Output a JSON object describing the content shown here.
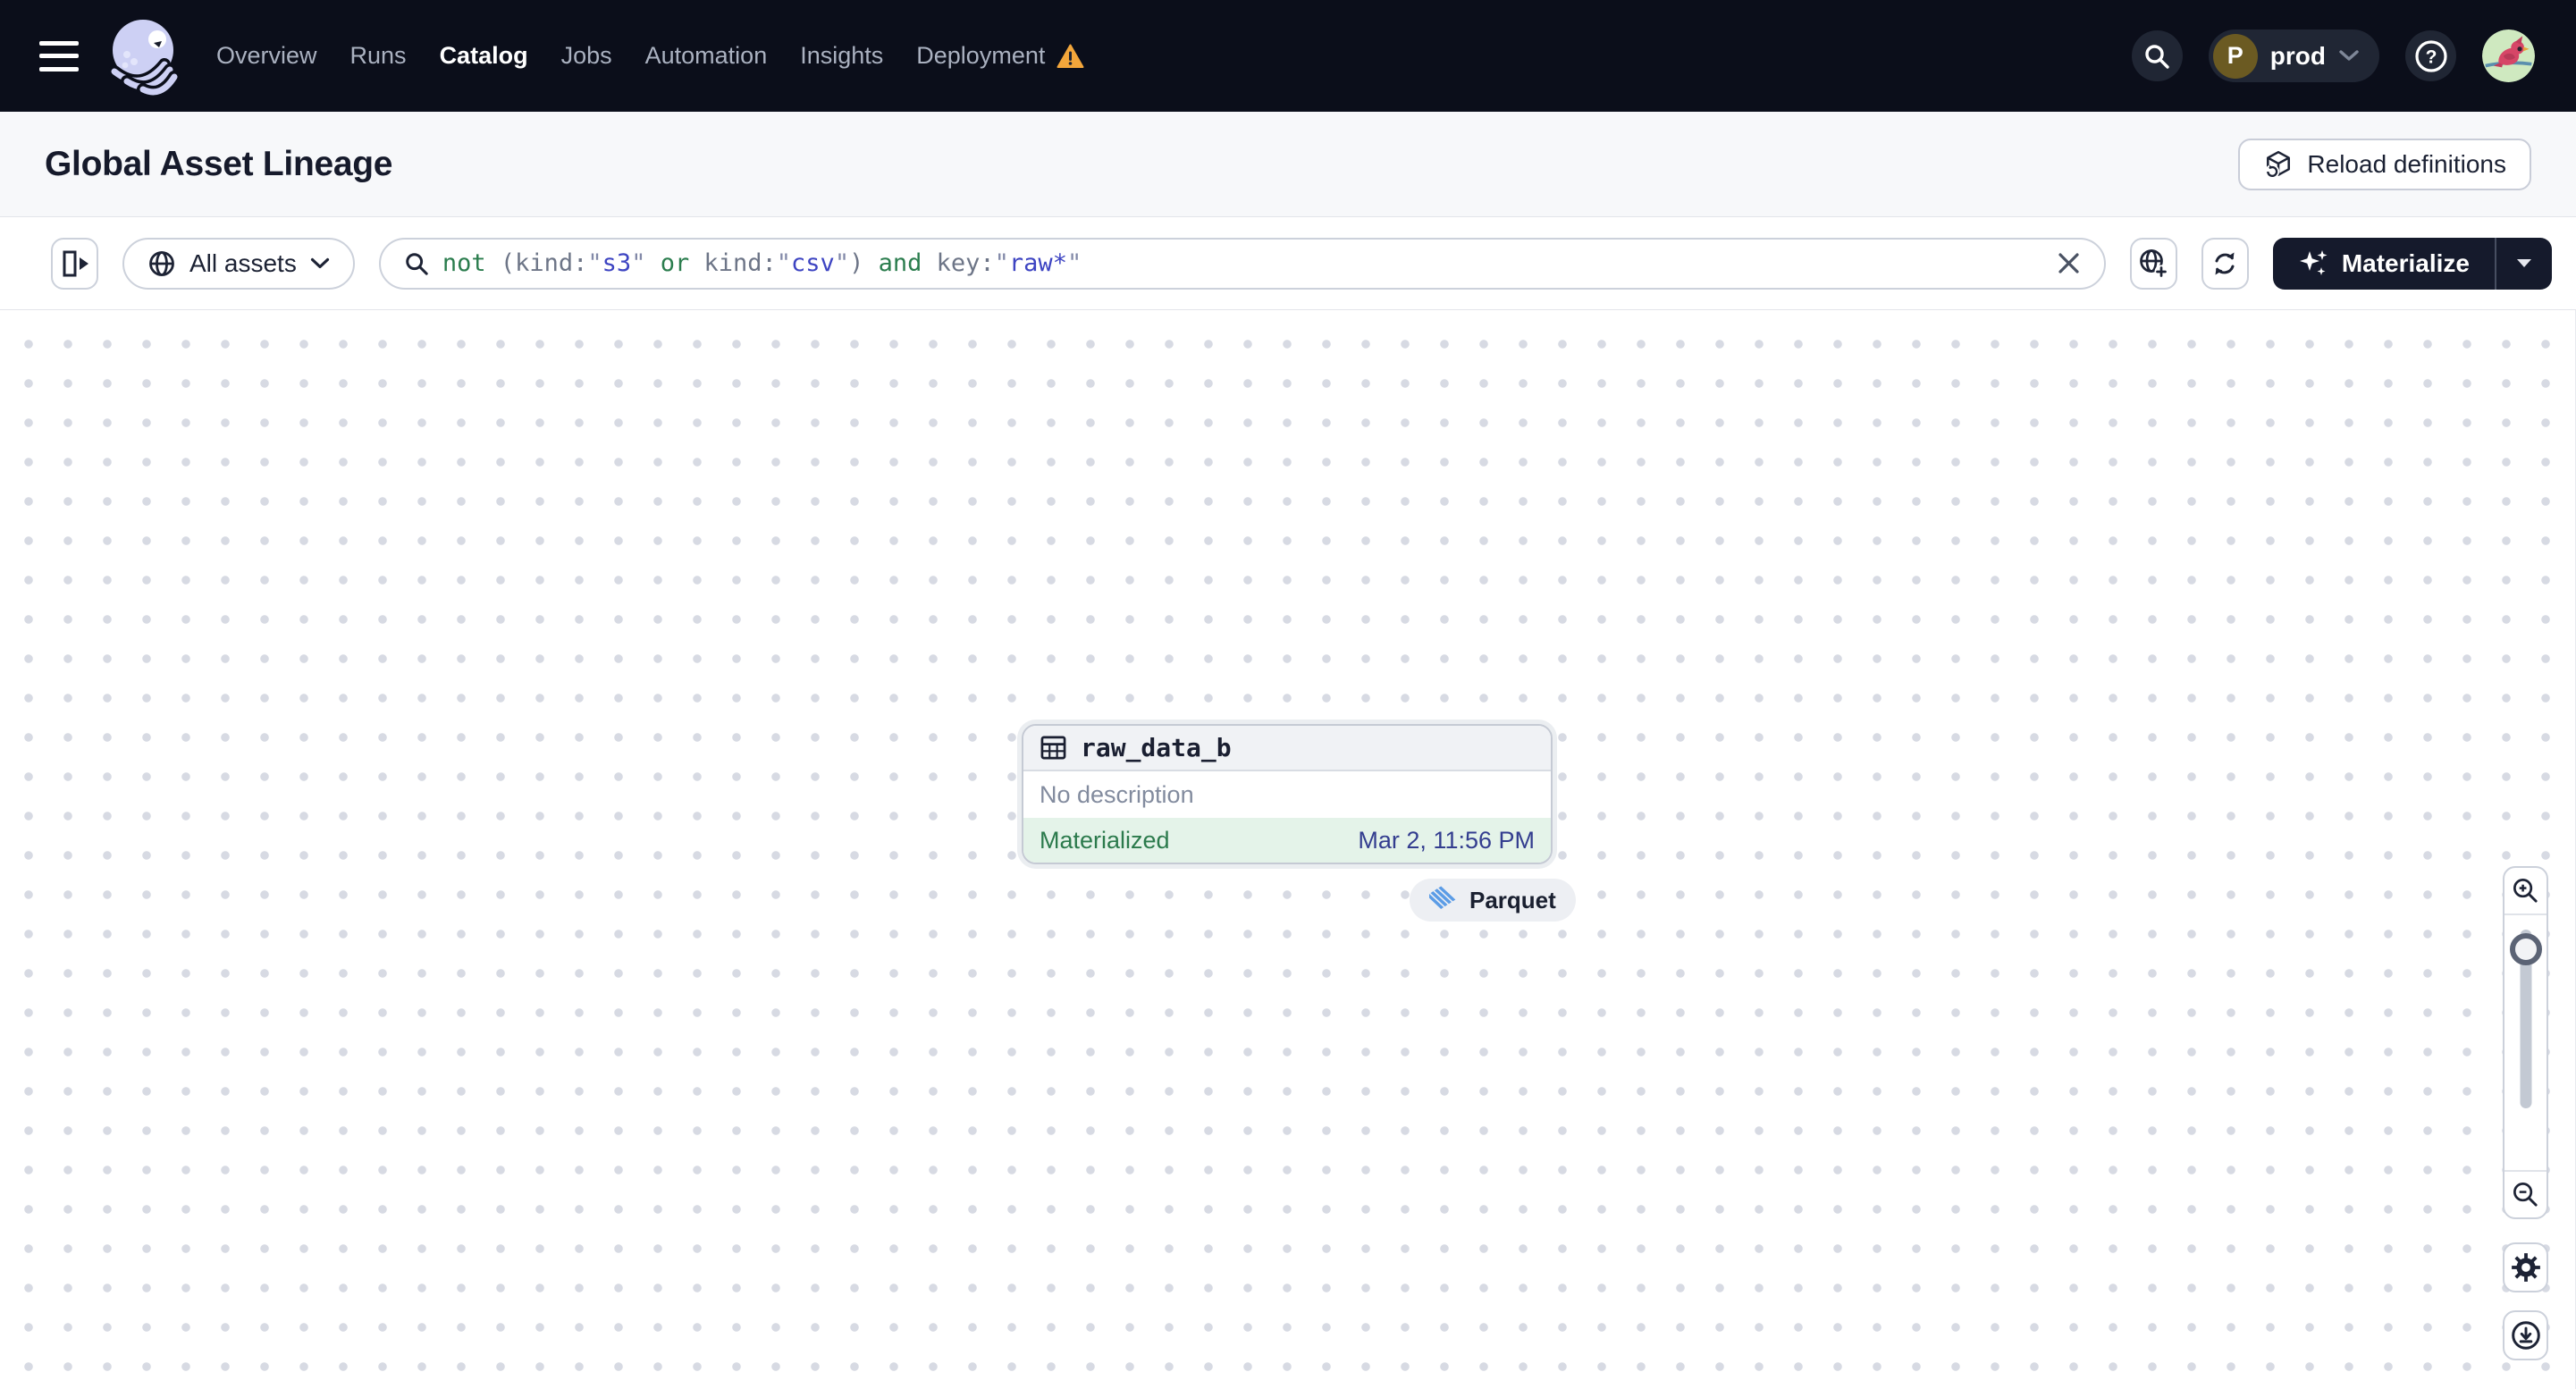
{
  "navbar": {
    "logo_name": "dagster-logo",
    "items": [
      {
        "label": "Overview",
        "active": false,
        "warning": false
      },
      {
        "label": "Runs",
        "active": false,
        "warning": false
      },
      {
        "label": "Catalog",
        "active": true,
        "warning": false
      },
      {
        "label": "Jobs",
        "active": false,
        "warning": false
      },
      {
        "label": "Automation",
        "active": false,
        "warning": false
      },
      {
        "label": "Insights",
        "active": false,
        "warning": false
      },
      {
        "label": "Deployment",
        "active": false,
        "warning": true
      }
    ],
    "environment": {
      "initial": "P",
      "name": "prod"
    }
  },
  "page_header": {
    "title": "Global Asset Lineage",
    "reload_button": "Reload definitions"
  },
  "toolbar": {
    "asset_filter_label": "All assets",
    "search": {
      "full_query": "not (kind:\"s3\" or kind:\"csv\") and key:\"raw*\"",
      "segments": [
        {
          "text": "not ",
          "type": "operator"
        },
        {
          "text": "(",
          "type": "punct"
        },
        {
          "text": "kind:",
          "type": "attribute"
        },
        {
          "text": "\"",
          "type": "quote"
        },
        {
          "text": "s3",
          "type": "value"
        },
        {
          "text": "\" ",
          "type": "quote"
        },
        {
          "text": "or ",
          "type": "operator"
        },
        {
          "text": "kind:",
          "type": "attribute"
        },
        {
          "text": "\"",
          "type": "quote"
        },
        {
          "text": "csv",
          "type": "value"
        },
        {
          "text": "\"",
          "type": "quote"
        },
        {
          "text": ") ",
          "type": "punct"
        },
        {
          "text": "and ",
          "type": "operator"
        },
        {
          "text": "key:",
          "type": "attribute"
        },
        {
          "text": "\"",
          "type": "quote"
        },
        {
          "text": "raw*",
          "type": "value"
        },
        {
          "text": "\"",
          "type": "quote"
        }
      ]
    },
    "materialize_label": "Materialize"
  },
  "canvas": {
    "asset_node": {
      "name": "raw_data_b",
      "description": "No description",
      "status": "Materialized",
      "materialized_at": "Mar 2, 11:56 PM"
    },
    "kind_badge": "Parquet"
  },
  "colors": {
    "navbar_bg": "#0b0e1a",
    "operator_green": "#2b7d4e",
    "value_blue": "#3d44c2",
    "materialized_green": "#2b7a4c",
    "timestamp_indigo": "#333d8f",
    "warning_orange": "#f3a63b",
    "kind_icon_blue": "#5b9ce6",
    "node_footer_bg": "#e4f3e9"
  }
}
